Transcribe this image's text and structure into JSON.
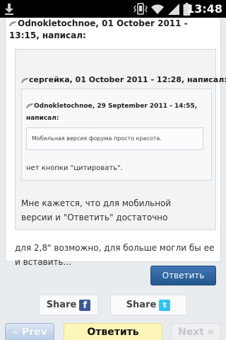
{
  "status_bar": {
    "time": "13:48",
    "icons": [
      "download-icon",
      "vibrate-icon",
      "wifi-icon",
      "signal-icon",
      "battery-icon"
    ]
  },
  "post": {
    "header": "Odnokletochnoe, 01 October 2011 - 13:15, написал:",
    "quote": {
      "header": "сергейка, 01 October 2011 - 12:28, написал:",
      "inner_quote": {
        "header": "Odnokletochnoe, 29 September 2011 - 14:55, написал:",
        "box_text": "Мобильная версия форума просто красота.",
        "text": "нет кнопки \"цитировать\"."
      },
      "reply": "Мне кажется, что для мобильной версии и \"Ответить\" достаточно"
    },
    "body": "для 2,8\" возможно, для больше могли бы ее и вставить..."
  },
  "reply_button": "Ответить",
  "share": {
    "facebook_label": "Share",
    "facebook_icon": "f",
    "twitter_label": "Share",
    "twitter_icon": "t"
  },
  "nav": {
    "prev": "« Prev",
    "reply": "Ответить",
    "next": "Next »"
  },
  "colors": {
    "reply_button": "#2d68a6",
    "nav_reply_bg": "#fdf6b9",
    "facebook": "#3b5998",
    "twitter": "#33c3f0"
  }
}
